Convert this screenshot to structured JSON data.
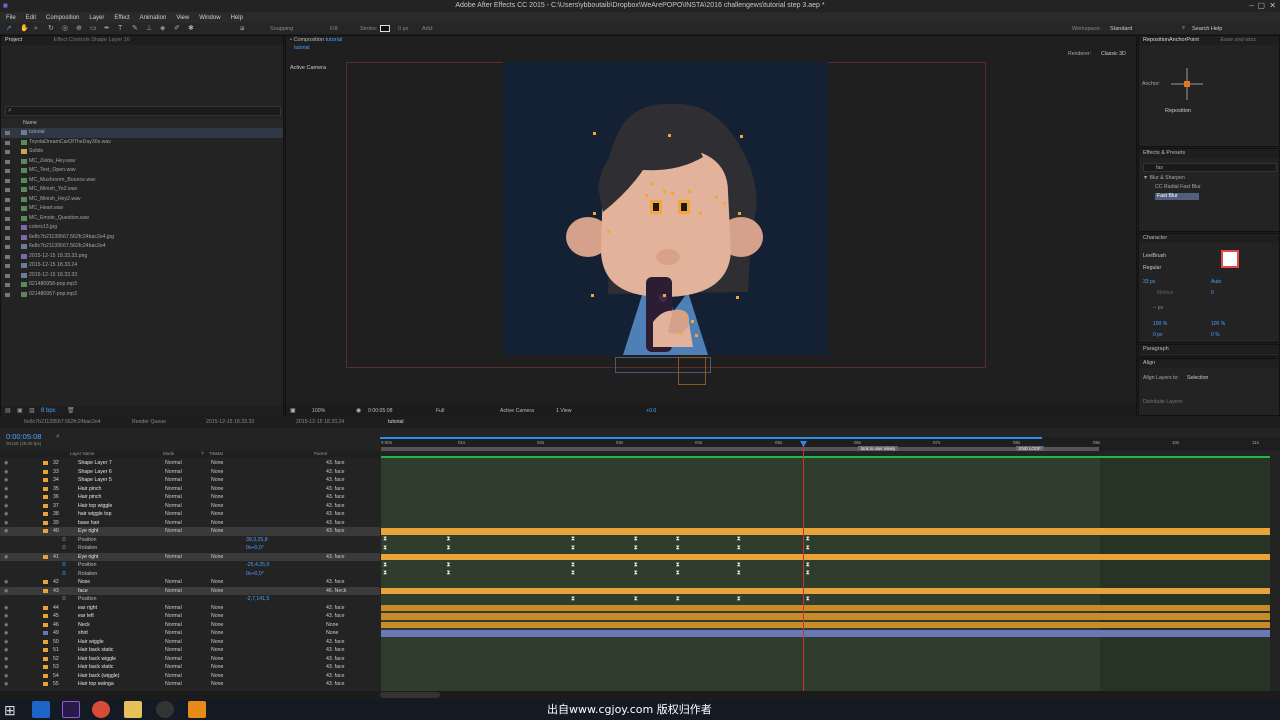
{
  "window": {
    "title": "Adobe After Effects CC 2015 - C:\\Users\\ybboutaib\\Dropbox\\WeArePOPO\\INSTA\\2016 challengews\\tutorial step 3.aep *"
  },
  "menu": [
    "File",
    "Edit",
    "Composition",
    "Layer",
    "Effect",
    "Animation",
    "View",
    "Window",
    "Help"
  ],
  "toolbar": {
    "snapping": "Snapping",
    "fill": "Fill:",
    "stroke": "Stroke:",
    "px": "0 px",
    "add": "Add:",
    "workspace_label": "Workspace:",
    "workspace_value": "Standard",
    "search": "Search Help"
  },
  "project": {
    "tabs": [
      "Project",
      "Effect Controls Shape Layer 16"
    ],
    "column": "Name",
    "items": [
      {
        "name": "tutorial",
        "type": "comp"
      },
      {
        "name": "ToyotaDreamCarOfTheDay30s.wav",
        "type": "audio"
      },
      {
        "name": "Solids",
        "type": "folder"
      },
      {
        "name": "MC_Zelda_Hey.wav",
        "type": "audio"
      },
      {
        "name": "MC_Text_Open.wav",
        "type": "audio"
      },
      {
        "name": "MC_Mushroom_Bounce.wav",
        "type": "audio"
      },
      {
        "name": "MC_Minish_Yo2.wav",
        "type": "audio"
      },
      {
        "name": "MC_Minish_Hey2.wav",
        "type": "audio"
      },
      {
        "name": "MC_Heart.wav",
        "type": "audio"
      },
      {
        "name": "MC_Emote_Question.wav",
        "type": "audio"
      },
      {
        "name": "colors13.jpg",
        "type": "image"
      },
      {
        "name": "6e8c7b21139567.562fc24bac2e4.jpg",
        "type": "image"
      },
      {
        "name": "6e8c7b21139567.562fc24bac2e4",
        "type": "comp"
      },
      {
        "name": "2015-12-15 18.33.33.png",
        "type": "image"
      },
      {
        "name": "2015-12-15 18.33.24",
        "type": "comp"
      },
      {
        "name": "2015-12-15 18.33.33",
        "type": "comp"
      },
      {
        "name": "021480958-pop.mp3",
        "type": "audio"
      },
      {
        "name": "021480957-pop.mp3",
        "type": "audio"
      }
    ],
    "bpc": "8 bpc"
  },
  "composition": {
    "tab": "Composition",
    "tab_name": "tutorial",
    "subtab": "tutorial",
    "renderer_label": "Renderer:",
    "renderer": "Classic 3D",
    "camera": "Active Camera",
    "zoom": "100%",
    "timecode": "0:00:05:08",
    "quality": "Full",
    "view_camera": "Active Camera",
    "views": "1 View",
    "exposure": "+0.0"
  },
  "right": {
    "anchor_tab": "RepositionAnchorPoint",
    "ease_tab": "Ease and wizz",
    "anchor_label": "Anchor:",
    "reposition": "Reposition",
    "effects_title": "Effects & Presets",
    "effects_search": "fas",
    "category": "Blur & Sharpen",
    "effect1": "CC Radial Fast Blur",
    "effect2": "Fast Blur",
    "character_title": "Character",
    "font": "LeviBrush",
    "style": "Regular",
    "size": "33 px",
    "leading": "Auto",
    "metrics": "Metrics",
    "tracking": "0",
    "stroke": "-- px",
    "vscale": "100 %",
    "hscale": "100 %",
    "baseline": "0 px",
    "tsume": "0 %",
    "paragraph_title": "Paragraph",
    "align_title": "Align",
    "align_to_label": "Align Layers to:",
    "align_to": "Selection",
    "distribute": "Distribute Layers:"
  },
  "timeline": {
    "tabs": [
      "6e8c7b21139567.562fc24bac2e4",
      "Render Queue",
      "2015-12-15 18.33.33",
      "2015-12-15 18.33.24",
      "tutorial"
    ],
    "timecode": "0:00:05:08",
    "fps": "00128 (25.00 fps)",
    "headers": {
      "layer": "Layer Name",
      "mode": "Mode",
      "t": "T",
      "trkmat": "TrkMat",
      "parent": "Parent"
    },
    "ruler": [
      "0:00s",
      "01s",
      "02s",
      "03s",
      "04s",
      "05s",
      "06s",
      "07s",
      "08s",
      "09s",
      "10s",
      "11s"
    ],
    "markers": [
      "look to user slowly",
      "END LOOP"
    ],
    "layers": [
      {
        "num": "32",
        "name": "Shape Layer 7",
        "mode": "Normal",
        "trk": "None",
        "parent": "43. face"
      },
      {
        "num": "33",
        "name": "Shape Layer 6",
        "mode": "Normal",
        "trk": "None",
        "parent": "43. face"
      },
      {
        "num": "34",
        "name": "Shape Layer 5",
        "mode": "Normal",
        "trk": "None",
        "parent": "43. face"
      },
      {
        "num": "35",
        "name": "Hair pinch",
        "mode": "Normal",
        "trk": "None",
        "parent": "43. face"
      },
      {
        "num": "36",
        "name": "Hair pinch",
        "mode": "Normal",
        "trk": "None",
        "parent": "43. face"
      },
      {
        "num": "37",
        "name": "Hair top wiggle",
        "mode": "Normal",
        "trk": "None",
        "parent": "43. face"
      },
      {
        "num": "38",
        "name": "hair wiggle top",
        "mode": "Normal",
        "trk": "None",
        "parent": "43. face"
      },
      {
        "num": "39",
        "name": "base hair",
        "mode": "Normal",
        "trk": "None",
        "parent": "43. face"
      },
      {
        "num": "40",
        "name": "Eye right",
        "mode": "Normal",
        "trk": "None",
        "parent": "43. face"
      },
      {
        "num": "",
        "name": "Position",
        "prop": true,
        "value": "39,3,25,8"
      },
      {
        "num": "",
        "name": "Rotation",
        "prop": true,
        "value": "0x+0,0°"
      },
      {
        "num": "41",
        "name": "Eye right",
        "mode": "Normal",
        "trk": "None",
        "parent": "43. face"
      },
      {
        "num": "",
        "name": "Position",
        "prop": true,
        "value": "-25,4,25,0"
      },
      {
        "num": "",
        "name": "Rotation",
        "prop": true,
        "value": "0x+0,0°"
      },
      {
        "num": "42",
        "name": "Nose",
        "mode": "Normal",
        "trk": "None",
        "parent": "43. face"
      },
      {
        "num": "43",
        "name": "face",
        "mode": "Normal",
        "trk": "None",
        "parent": "46. Neck"
      },
      {
        "num": "",
        "name": "Position",
        "prop": true,
        "value": "-2,7,141,5"
      },
      {
        "num": "44",
        "name": "ear right",
        "mode": "Normal",
        "trk": "None",
        "parent": "43. face"
      },
      {
        "num": "45",
        "name": "ear left",
        "mode": "Normal",
        "trk": "None",
        "parent": "43. face"
      },
      {
        "num": "46",
        "name": "Neck",
        "mode": "Normal",
        "trk": "None",
        "parent": "None"
      },
      {
        "num": "49",
        "name": "shirt",
        "mode": "Normal",
        "trk": "None",
        "parent": "None"
      },
      {
        "num": "50",
        "name": "Hair wiggle",
        "mode": "Normal",
        "trk": "None",
        "parent": "43. face"
      },
      {
        "num": "51",
        "name": "Hair back static",
        "mode": "Normal",
        "trk": "None",
        "parent": "43. face"
      },
      {
        "num": "52",
        "name": "Hair back wiggle",
        "mode": "Normal",
        "trk": "None",
        "parent": "43. face"
      },
      {
        "num": "53",
        "name": "Hair back static",
        "mode": "Normal",
        "trk": "None",
        "parent": "43. face"
      },
      {
        "num": "54",
        "name": "Hair back (wiggle)",
        "mode": "Normal",
        "trk": "None",
        "parent": "43. face"
      },
      {
        "num": "55",
        "name": "Hair top swinga",
        "mode": "Normal",
        "trk": "None",
        "parent": "43. face"
      }
    ]
  },
  "watermark": "出自www.cgjoy.com 版权归作者",
  "colors": {
    "accent": "#2d8ceb",
    "bar_orange": "#e8a33a",
    "track_green": "#2e3d2c",
    "playhead": "#d03030",
    "layer_blue": "#6a78b5"
  }
}
